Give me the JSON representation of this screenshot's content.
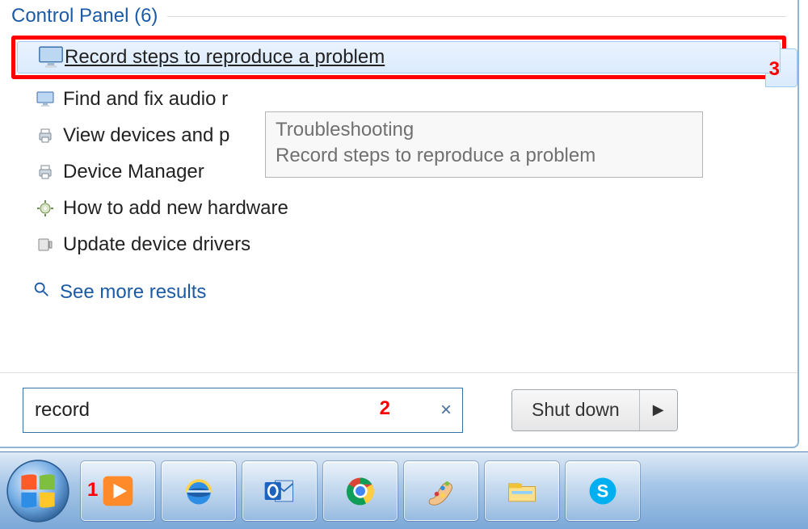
{
  "group": {
    "header": "Control Panel (6)",
    "items": [
      {
        "label": "Record steps to reproduce a problem",
        "icon": "monitor-icon",
        "selected": true
      },
      {
        "label": "Find and fix audio r",
        "icon": "monitor-icon"
      },
      {
        "label": "View devices and p",
        "icon": "printer-icon"
      },
      {
        "label": "Device Manager",
        "icon": "printer-icon"
      },
      {
        "label": "How to add new hardware",
        "icon": "gear-icon"
      },
      {
        "label": "Update device drivers",
        "icon": "device-icon"
      }
    ],
    "see_more": "See more results"
  },
  "tooltip": {
    "line1": "Troubleshooting",
    "line2": "Record steps to reproduce a problem"
  },
  "search": {
    "value": "record",
    "clear_glyph": "×"
  },
  "shutdown": {
    "label": "Shut down",
    "arrow": "▶"
  },
  "annotations": {
    "a1": "1",
    "a2": "2",
    "a3": "3"
  },
  "taskbar": {
    "items": [
      {
        "name": "media-player-icon"
      },
      {
        "name": "internet-explorer-icon"
      },
      {
        "name": "outlook-icon"
      },
      {
        "name": "chrome-icon"
      },
      {
        "name": "paint-icon"
      },
      {
        "name": "file-explorer-icon"
      },
      {
        "name": "skype-icon"
      }
    ]
  }
}
